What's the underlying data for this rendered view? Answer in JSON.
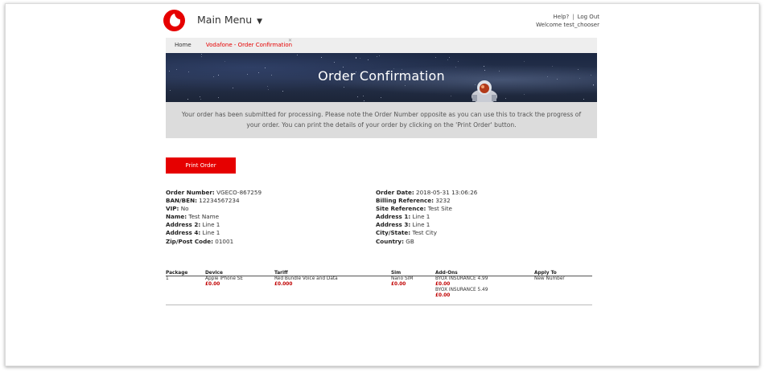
{
  "header": {
    "main_menu_label": "Main Menu",
    "main_menu_caret": "▼",
    "help_label": "Help?",
    "separator": "|",
    "logout_label": "Log Out",
    "welcome_text": "Welcome test_chooser"
  },
  "breadcrumb": {
    "home": "Home",
    "current": "Vodafone - Order Confirmation"
  },
  "banner": {
    "title": "Order Confirmation"
  },
  "notice": {
    "text": "Your order has been submitted for processing. Please note the Order Number opposite as you can use this to track the progress of your order. You can print the details of your order by clicking on the 'Print Order' button."
  },
  "actions": {
    "print_label": "Print Order"
  },
  "order_details_left": [
    {
      "label": "Order Number:",
      "value": "VGECO-867259"
    },
    {
      "label": "BAN/BEN:",
      "value": "12234567234"
    },
    {
      "label": "VIP:",
      "value": "No"
    },
    {
      "label": "Name:",
      "value": "Test Name"
    },
    {
      "label": "Address 2:",
      "value": "Line 1"
    },
    {
      "label": "Address 4:",
      "value": "Line 1"
    },
    {
      "label": "Zip/Post Code:",
      "value": "01001"
    }
  ],
  "order_details_right": [
    {
      "label": "Order Date:",
      "value": "2018-05-31 13:06:26"
    },
    {
      "label": "Billing Reference:",
      "value": "3232"
    },
    {
      "label": "Site Reference:",
      "value": "Test Site"
    },
    {
      "label": "Address 1:",
      "value": "Line 1"
    },
    {
      "label": "Address 3:",
      "value": "Line 1"
    },
    {
      "label": "City/State:",
      "value": "Test City"
    },
    {
      "label": "Country:",
      "value": "GB"
    }
  ],
  "table": {
    "headers": {
      "package": "Package",
      "device": "Device",
      "tariff": "Tariff",
      "sim": "Sim",
      "addons": "Add-Ons",
      "apply": "Apply To"
    },
    "rows": [
      {
        "package": "1",
        "device": "Apple iPhone SE",
        "device_price": "£0.00",
        "tariff": "Red Bundle Voice and Data",
        "tariff_price": "£0.000",
        "sim": "Nano SIM",
        "sim_price": "£0.00",
        "addons": [
          {
            "name": "BYOX INSURANCE 4.99",
            "price": "£0.00"
          },
          {
            "name": "BYOX INSURANCE 5.49",
            "price": "£0.00"
          }
        ],
        "apply": "New Number"
      }
    ]
  },
  "colors": {
    "brand_red": "#e60000",
    "price_red": "#c00000",
    "notice_bg": "#dcdcdc",
    "breadcrumb_bg": "#eeeeee"
  }
}
